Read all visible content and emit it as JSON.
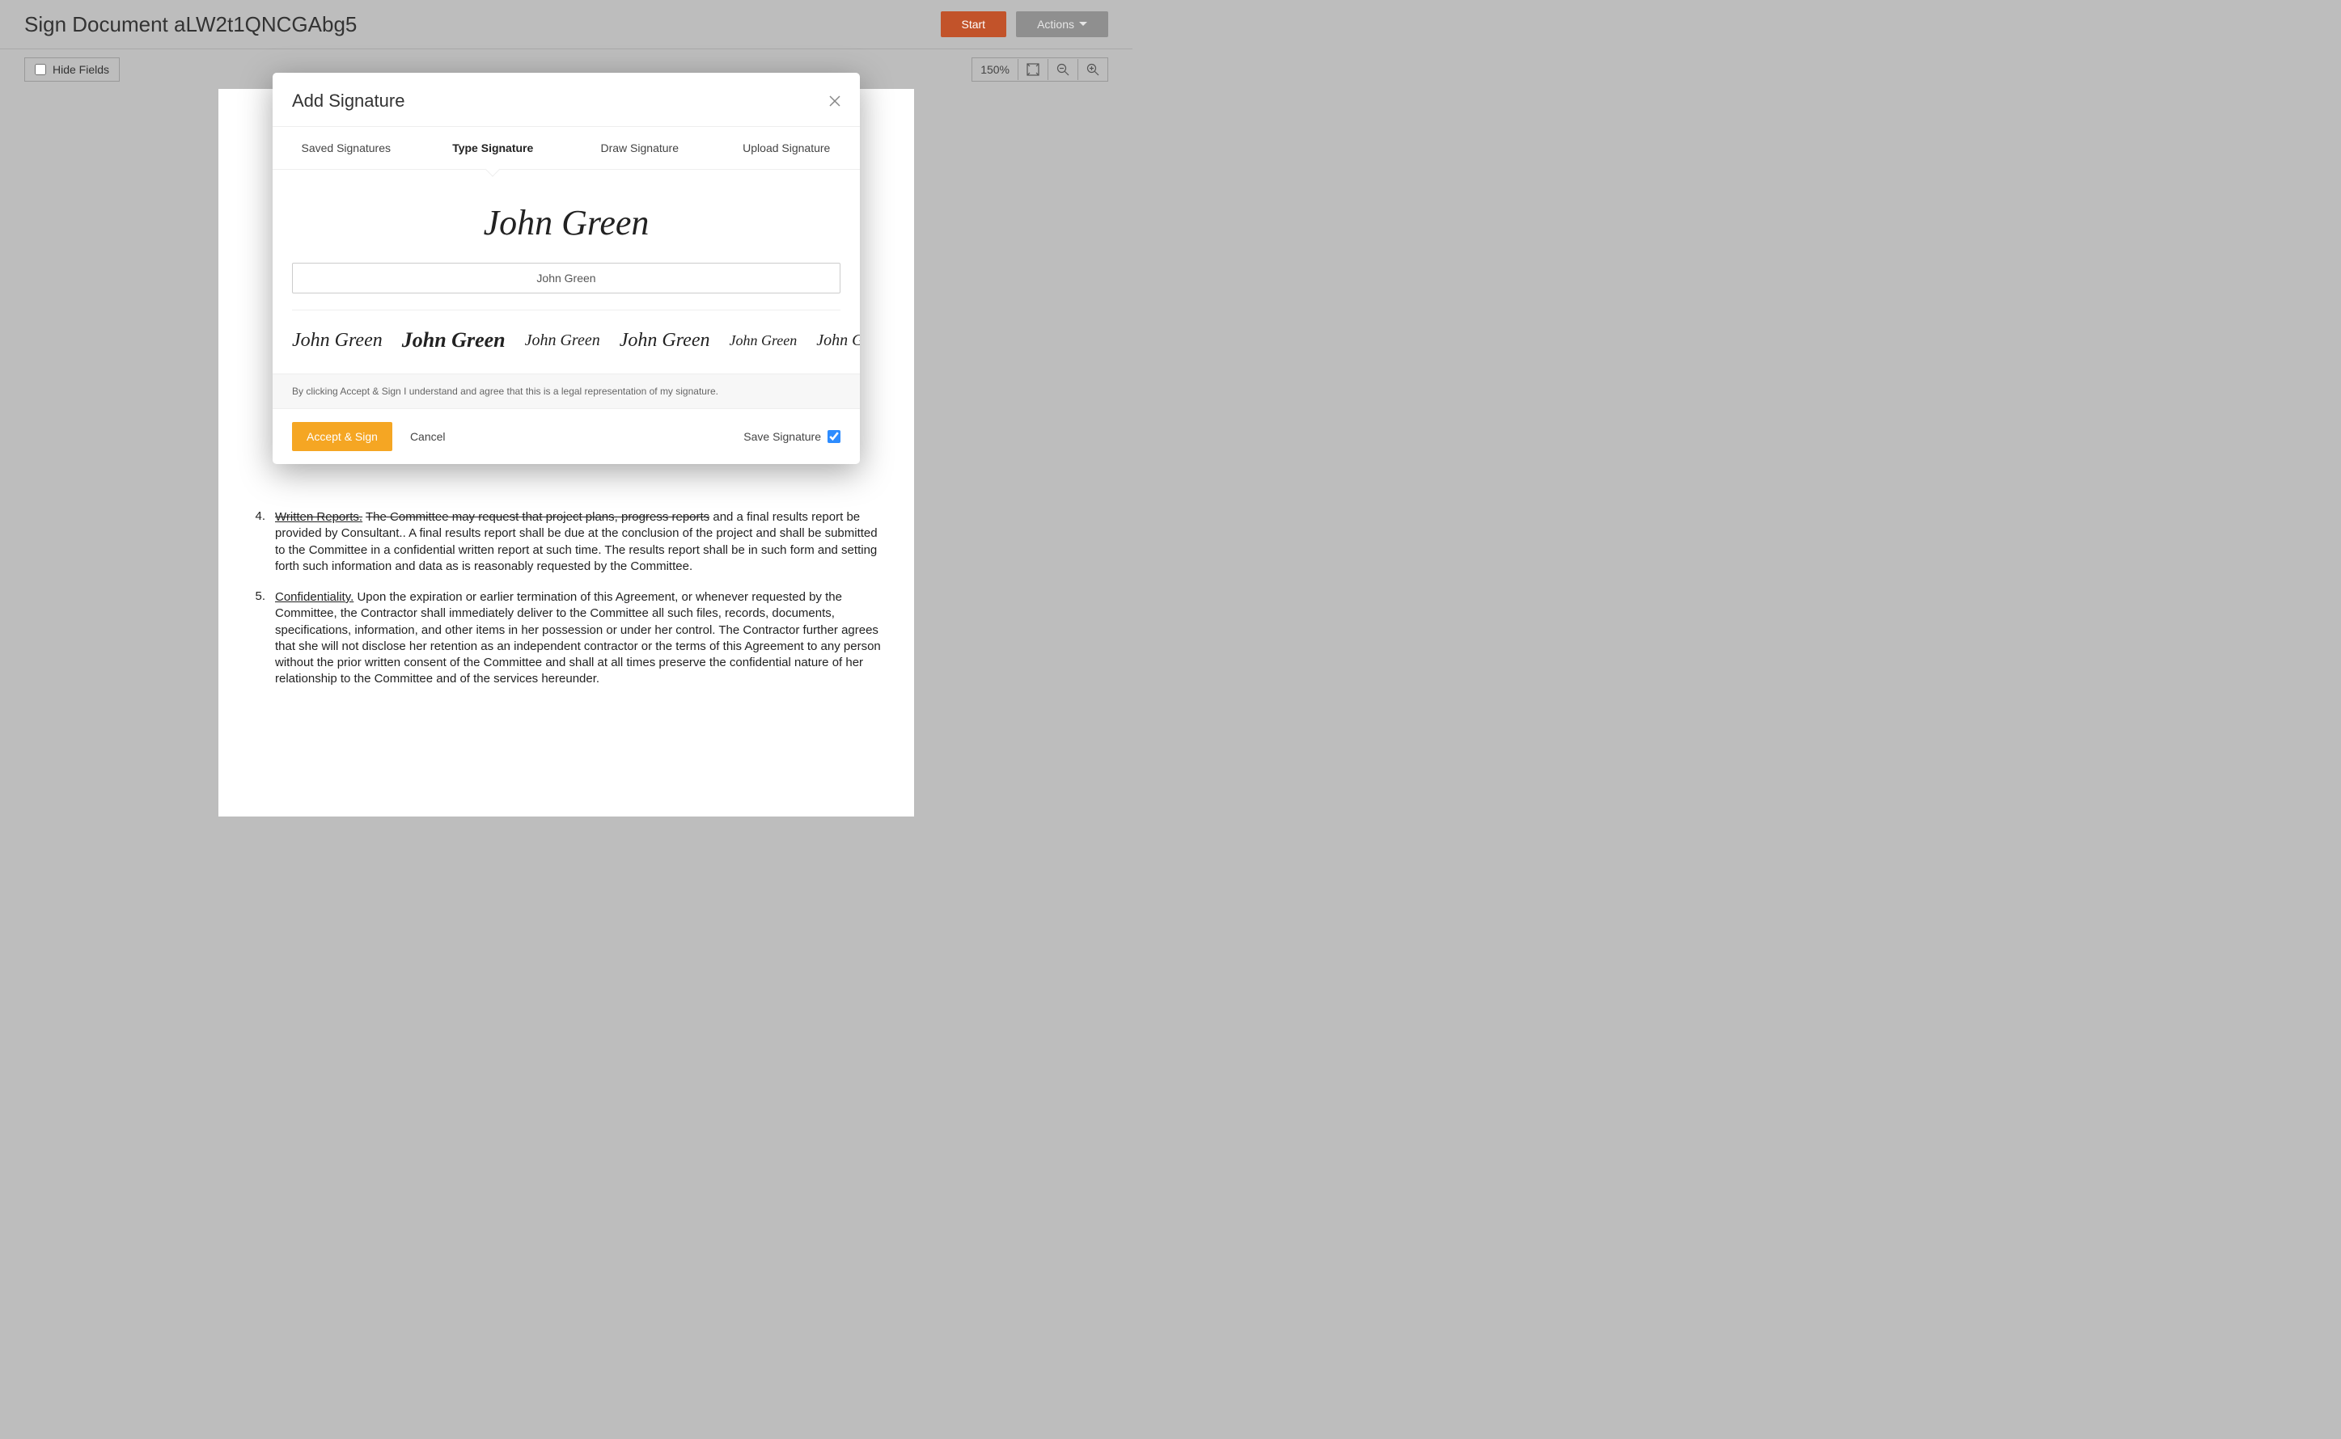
{
  "header": {
    "title": "Sign Document aLW2t1QNCGAbg5",
    "start_label": "Start",
    "actions_label": "Actions"
  },
  "toolbar": {
    "hide_fields_label": "Hide Fields",
    "zoom_label": "150%"
  },
  "document": {
    "item4_num": "4.",
    "item4_heading": "Written Reports.",
    "item4_tail": "The Committee may request that project plans, progress reports",
    "item4_body": "and a final results report be provided by Consultant..  A final results report shall be due at the conclusion of the project and shall be submitted to the Committee in a confidential written report at such time. The results report shall be in such form and setting forth such information and data as is reasonably requested by the Committee.",
    "item5_num": "5.",
    "item5_heading": "Confidentiality.",
    "item5_body": "Upon the expiration or earlier termination of this Agreement, or whenever requested by the Committee, the Contractor shall immediately deliver to the Committee all such files, records, documents, specifications, information, and other items in her possession or under her control.  The Contractor further agrees that she will not disclose her retention as an independent contractor or the terms of this Agreement to any person without the prior written consent of the Committee and shall at all times preserve the confidential nature of her relationship to the Committee and of the services hereunder."
  },
  "modal": {
    "title": "Add Signature",
    "tabs": {
      "saved": "Saved Signatures",
      "type": "Type Signature",
      "draw": "Draw Signature",
      "upload": "Upload Signature"
    },
    "preview_name": "John Green",
    "input_value": "John Green",
    "styles": [
      "John Green",
      "John Green",
      "John Green",
      "John Green",
      "John Green",
      "John Green"
    ],
    "disclaimer": "By clicking Accept & Sign I understand and agree that this is a legal representation of my signature.",
    "accept_label": "Accept & Sign",
    "cancel_label": "Cancel",
    "save_label": "Save Signature",
    "save_checked": true
  }
}
